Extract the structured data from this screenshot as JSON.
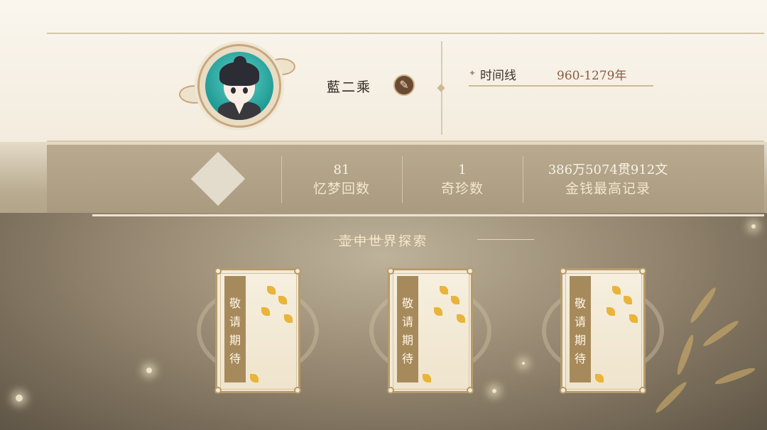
{
  "player": {
    "name": "藍二乘",
    "edit_icon": "brush-icon"
  },
  "timeline": {
    "label": "时间线",
    "value": "960-1279年",
    "marker_icon": "diamond-marker-icon"
  },
  "stats": [
    {
      "value": "81",
      "label": "忆梦回数"
    },
    {
      "value": "1",
      "label": "奇珍数"
    },
    {
      "value": "386万5074贯912文",
      "label": "金钱最高记录"
    }
  ],
  "section": {
    "title": "壶中世界探索"
  },
  "cards": [
    {
      "text": "敬请期待"
    },
    {
      "text": "敬请期待"
    },
    {
      "text": "敬请期待"
    }
  ],
  "colors": {
    "accent": "#8e5a3f",
    "gold": "#c9a77b",
    "stats_bg": "#b9aa8f"
  }
}
